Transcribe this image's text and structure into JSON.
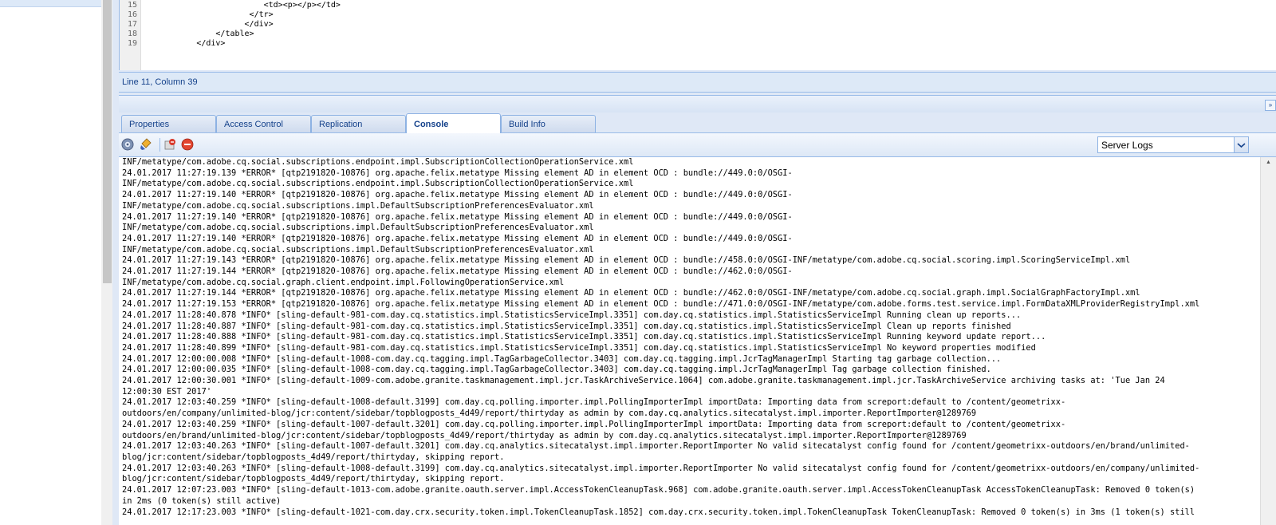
{
  "editor": {
    "line_numbers": [
      "15",
      "16",
      "17",
      "18",
      "19"
    ],
    "lines": [
      {
        "indent": 30,
        "text": "<td><p></p></td>"
      },
      {
        "indent": 27,
        "text": "</tr>"
      },
      {
        "indent": 26,
        "text": "</div>"
      },
      {
        "indent": 20,
        "text": "</table>"
      },
      {
        "indent": 16,
        "text": "</div>"
      }
    ]
  },
  "status": {
    "position": "Line 11, Column 39"
  },
  "tabs": [
    {
      "label": "Properties",
      "active": false
    },
    {
      "label": "Access Control",
      "active": false
    },
    {
      "label": "Replication",
      "active": false
    },
    {
      "label": "Console",
      "active": true
    },
    {
      "label": "Build Info",
      "active": false
    }
  ],
  "toolbar": {
    "icons": [
      "settings-icon",
      "clear-icon",
      "stop-icon",
      "terminate-icon"
    ]
  },
  "log_select": {
    "value": "Server Logs"
  },
  "log_lines": [
    "INF/metatype/com.adobe.cq.social.subscriptions.endpoint.impl.SubscriptionCollectionOperationService.xml",
    "24.01.2017 11:27:19.139 *ERROR* [qtp2191820-10876] org.apache.felix.metatype Missing element AD in element OCD : bundle://449.0:0/OSGI-",
    "INF/metatype/com.adobe.cq.social.subscriptions.endpoint.impl.SubscriptionCollectionOperationService.xml",
    "24.01.2017 11:27:19.140 *ERROR* [qtp2191820-10876] org.apache.felix.metatype Missing element AD in element OCD : bundle://449.0:0/OSGI-",
    "INF/metatype/com.adobe.cq.social.subscriptions.impl.DefaultSubscriptionPreferencesEvaluator.xml",
    "24.01.2017 11:27:19.140 *ERROR* [qtp2191820-10876] org.apache.felix.metatype Missing element AD in element OCD : bundle://449.0:0/OSGI-",
    "INF/metatype/com.adobe.cq.social.subscriptions.impl.DefaultSubscriptionPreferencesEvaluator.xml",
    "24.01.2017 11:27:19.140 *ERROR* [qtp2191820-10876] org.apache.felix.metatype Missing element AD in element OCD : bundle://449.0:0/OSGI-",
    "INF/metatype/com.adobe.cq.social.subscriptions.impl.DefaultSubscriptionPreferencesEvaluator.xml",
    "24.01.2017 11:27:19.143 *ERROR* [qtp2191820-10876] org.apache.felix.metatype Missing element AD in element OCD : bundle://458.0:0/OSGI-INF/metatype/com.adobe.cq.social.scoring.impl.ScoringServiceImpl.xml",
    "24.01.2017 11:27:19.144 *ERROR* [qtp2191820-10876] org.apache.felix.metatype Missing element AD in element OCD : bundle://462.0:0/OSGI-",
    "INF/metatype/com.adobe.cq.social.graph.client.endpoint.impl.FollowingOperationService.xml",
    "24.01.2017 11:27:19.144 *ERROR* [qtp2191820-10876] org.apache.felix.metatype Missing element AD in element OCD : bundle://462.0:0/OSGI-INF/metatype/com.adobe.cq.social.graph.impl.SocialGraphFactoryImpl.xml",
    "24.01.2017 11:27:19.153 *ERROR* [qtp2191820-10876] org.apache.felix.metatype Missing element AD in element OCD : bundle://471.0:0/OSGI-INF/metatype/com.adobe.forms.test.service.impl.FormDataXMLProviderRegistryImpl.xml",
    "24.01.2017 11:28:40.878 *INFO* [sling-default-981-com.day.cq.statistics.impl.StatisticsServiceImpl.3351] com.day.cq.statistics.impl.StatisticsServiceImpl Running clean up reports...",
    "24.01.2017 11:28:40.887 *INFO* [sling-default-981-com.day.cq.statistics.impl.StatisticsServiceImpl.3351] com.day.cq.statistics.impl.StatisticsServiceImpl Clean up reports finished",
    "24.01.2017 11:28:40.888 *INFO* [sling-default-981-com.day.cq.statistics.impl.StatisticsServiceImpl.3351] com.day.cq.statistics.impl.StatisticsServiceImpl Running keyword update report...",
    "24.01.2017 11:28:40.899 *INFO* [sling-default-981-com.day.cq.statistics.impl.StatisticsServiceImpl.3351] com.day.cq.statistics.impl.StatisticsServiceImpl No keyword properties modified",
    "24.01.2017 12:00:00.008 *INFO* [sling-default-1008-com.day.cq.tagging.impl.TagGarbageCollector.3403] com.day.cq.tagging.impl.JcrTagManagerImpl Starting tag garbage collection...",
    "24.01.2017 12:00:00.035 *INFO* [sling-default-1008-com.day.cq.tagging.impl.TagGarbageCollector.3403] com.day.cq.tagging.impl.JcrTagManagerImpl Tag garbage collection finished.",
    "24.01.2017 12:00:30.001 *INFO* [sling-default-1009-com.adobe.granite.taskmanagement.impl.jcr.TaskArchiveService.1064] com.adobe.granite.taskmanagement.impl.jcr.TaskArchiveService archiving tasks at: 'Tue Jan 24",
    "12:00:30 EST 2017'",
    "24.01.2017 12:03:40.259 *INFO* [sling-default-1008-default.3199] com.day.cq.polling.importer.impl.PollingImporterImpl importData: Importing data from screport:default to /content/geometrixx-",
    "outdoors/en/company/unlimited-blog/jcr:content/sidebar/topblogposts_4d49/report/thirtyday as admin by com.day.cq.analytics.sitecatalyst.impl.importer.ReportImporter@1289769",
    "24.01.2017 12:03:40.259 *INFO* [sling-default-1007-default.3201] com.day.cq.polling.importer.impl.PollingImporterImpl importData: Importing data from screport:default to /content/geometrixx-",
    "outdoors/en/brand/unlimited-blog/jcr:content/sidebar/topblogposts_4d49/report/thirtyday as admin by com.day.cq.analytics.sitecatalyst.impl.importer.ReportImporter@1289769",
    "24.01.2017 12:03:40.263 *INFO* [sling-default-1007-default.3201] com.day.cq.analytics.sitecatalyst.impl.importer.ReportImporter No valid sitecatalyst config found for /content/geometrixx-outdoors/en/brand/unlimited-",
    "blog/jcr:content/sidebar/topblogposts_4d49/report/thirtyday, skipping report.",
    "24.01.2017 12:03:40.263 *INFO* [sling-default-1008-default.3199] com.day.cq.analytics.sitecatalyst.impl.importer.ReportImporter No valid sitecatalyst config found for /content/geometrixx-outdoors/en/company/unlimited-",
    "blog/jcr:content/sidebar/topblogposts_4d49/report/thirtyday, skipping report.",
    "24.01.2017 12:07:23.003 *INFO* [sling-default-1013-com.adobe.granite.oauth.server.impl.AccessTokenCleanupTask.968] com.adobe.granite.oauth.server.impl.AccessTokenCleanupTask AccessTokenCleanupTask: Removed 0 token(s)",
    "in 2ms (0 token(s) still active)",
    "24.01.2017 12:17:23.003 *INFO* [sling-default-1021-com.day.crx.security.token.impl.TokenCleanupTask.1852] com.day.crx.security.token.impl.TokenCleanupTask TokenCleanupTask: Removed 0 token(s) in 3ms (1 token(s) still"
  ]
}
